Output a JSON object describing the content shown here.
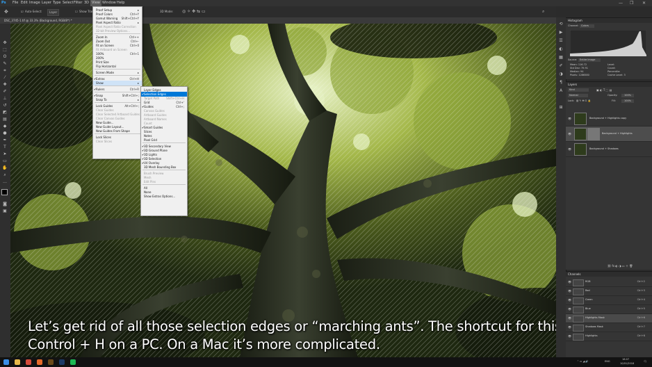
{
  "menubar": {
    "items": [
      "File",
      "Edit",
      "Image",
      "Layer",
      "Type",
      "Select",
      "Filter",
      "3D",
      "View",
      "Window",
      "Help"
    ],
    "window_controls": [
      "—",
      "❐",
      "✕"
    ]
  },
  "options_bar": {
    "auto_select_label": "Auto-Select:",
    "auto_select_value": "Layer",
    "show_transform_label": "Show Transform Controls",
    "mode_label": "3D Mode:"
  },
  "document_tab": {
    "title": "DSC_3745-1.tif @ 33.3% (Background, RGB/8*) *"
  },
  "view_menu": {
    "items": [
      {
        "label": "Proof Setup",
        "shortcut": "▸",
        "type": "normal"
      },
      {
        "label": "Proof Colors",
        "shortcut": "Ctrl+Y",
        "type": "normal"
      },
      {
        "label": "Gamut Warning",
        "shortcut": "Shift+Ctrl+Y",
        "type": "normal"
      },
      {
        "label": "Pixel Aspect Ratio",
        "shortcut": "▸",
        "type": "normal"
      },
      {
        "label": "Pixel Aspect Ratio Correction",
        "shortcut": "",
        "type": "disabled"
      },
      {
        "label": "32-bit Preview Options...",
        "shortcut": "",
        "type": "disabled"
      },
      {
        "type": "sep"
      },
      {
        "label": "Zoom In",
        "shortcut": "Ctrl++",
        "type": "normal"
      },
      {
        "label": "Zoom Out",
        "shortcut": "Ctrl+-",
        "type": "normal"
      },
      {
        "label": "Fit on Screen",
        "shortcut": "Ctrl+0",
        "type": "normal"
      },
      {
        "label": "Fit Artboard on Screen",
        "shortcut": "",
        "type": "disabled"
      },
      {
        "label": "100%",
        "shortcut": "Ctrl+1",
        "type": "normal"
      },
      {
        "label": "200%",
        "shortcut": "",
        "type": "normal"
      },
      {
        "label": "Print Size",
        "shortcut": "",
        "type": "normal"
      },
      {
        "label": "Flip Horizontal",
        "shortcut": "",
        "type": "normal"
      },
      {
        "type": "sep"
      },
      {
        "label": "Screen Mode",
        "shortcut": "▸",
        "type": "normal"
      },
      {
        "type": "sep"
      },
      {
        "label": "Extras",
        "shortcut": "Ctrl+H",
        "type": "checked"
      },
      {
        "label": "Show",
        "shortcut": "▸",
        "type": "submenu"
      },
      {
        "type": "sep"
      },
      {
        "label": "Rulers",
        "shortcut": "Ctrl+R",
        "type": "checked"
      },
      {
        "type": "sep"
      },
      {
        "label": "Snap",
        "shortcut": "Shift+Ctrl+;",
        "type": "checked"
      },
      {
        "label": "Snap To",
        "shortcut": "▸",
        "type": "normal"
      },
      {
        "type": "sep"
      },
      {
        "label": "Lock Guides",
        "shortcut": "Alt+Ctrl+;",
        "type": "normal"
      },
      {
        "label": "Clear Guides",
        "shortcut": "",
        "type": "disabled"
      },
      {
        "label": "Clear Selected Artboard Guides",
        "shortcut": "",
        "type": "disabled"
      },
      {
        "label": "Clear Canvas Guides",
        "shortcut": "",
        "type": "disabled"
      },
      {
        "label": "New Guide...",
        "shortcut": "",
        "type": "normal"
      },
      {
        "label": "New Guide Layout...",
        "shortcut": "",
        "type": "normal"
      },
      {
        "label": "New Guides From Shape",
        "shortcut": "",
        "type": "normal"
      },
      {
        "type": "sep"
      },
      {
        "label": "Lock Slices",
        "shortcut": "",
        "type": "normal"
      },
      {
        "label": "Clear Slices",
        "shortcut": "",
        "type": "disabled"
      }
    ]
  },
  "show_menu": {
    "items": [
      {
        "label": "Layer Edges",
        "shortcut": "",
        "type": "normal"
      },
      {
        "label": "Selection Edges",
        "shortcut": "",
        "type": "highlight"
      },
      {
        "label": "Target Path",
        "shortcut": "Shift+Ctrl+H",
        "type": "disabled"
      },
      {
        "label": "Grid",
        "shortcut": "Ctrl+'",
        "type": "normal"
      },
      {
        "label": "Guides",
        "shortcut": "Ctrl+;",
        "type": "checked"
      },
      {
        "label": "Canvas Guides",
        "shortcut": "",
        "type": "disabled"
      },
      {
        "label": "Artboard Guides",
        "shortcut": "",
        "type": "disabled"
      },
      {
        "label": "Artboard Names",
        "shortcut": "",
        "type": "disabled"
      },
      {
        "label": "Count",
        "shortcut": "",
        "type": "disabled"
      },
      {
        "label": "Smart Guides",
        "shortcut": "",
        "type": "checked"
      },
      {
        "label": "Slices",
        "shortcut": "",
        "type": "normal"
      },
      {
        "label": "Notes",
        "shortcut": "",
        "type": "normal"
      },
      {
        "label": "Pixel Grid",
        "shortcut": "",
        "type": "normal"
      },
      {
        "type": "sep"
      },
      {
        "label": "3D Secondary View",
        "shortcut": "",
        "type": "checked"
      },
      {
        "label": "3D Ground Plane",
        "shortcut": "",
        "type": "checked"
      },
      {
        "label": "3D Lights",
        "shortcut": "",
        "type": "checked"
      },
      {
        "label": "3D Selection",
        "shortcut": "",
        "type": "checked"
      },
      {
        "label": "UV Overlay",
        "shortcut": "",
        "type": "checked"
      },
      {
        "label": "3D Mesh Bounding Box",
        "shortcut": "",
        "type": "normal"
      },
      {
        "type": "sep"
      },
      {
        "label": "Brush Preview",
        "shortcut": "",
        "type": "disabled"
      },
      {
        "label": "Mesh",
        "shortcut": "",
        "type": "disabled"
      },
      {
        "label": "Edit Pins",
        "shortcut": "",
        "type": "disabled"
      },
      {
        "type": "sep"
      },
      {
        "label": "All",
        "shortcut": "",
        "type": "normal"
      },
      {
        "label": "None",
        "shortcut": "",
        "type": "normal"
      },
      {
        "label": "Show Extras Options...",
        "shortcut": "",
        "type": "normal"
      }
    ]
  },
  "histogram_panel": {
    "title": "Histogram",
    "channel_label": "Channel:",
    "channel_value": "Colors",
    "source_label": "Source:",
    "source_value": "Entire Image",
    "stats": [
      "Mean: 116.72",
      "Std Dev: 79.91",
      "Median: 94",
      "Pixels: 1286580",
      "Level:",
      "Count:",
      "Percentile:",
      "Cache Level: 3"
    ]
  },
  "layers_panel": {
    "title": "Layers",
    "search_placeholder": "Kind",
    "blend_mode": "Normal",
    "opacity_label": "Opacity:",
    "opacity_value": "100%",
    "lock_label": "Lock:",
    "fill_label": "Fill:",
    "fill_value": "100%",
    "layers": [
      {
        "name": "Background + Highlights copy",
        "selected": false
      },
      {
        "name": "Background + Highlights",
        "selected": true
      },
      {
        "name": "Background + Shadows",
        "selected": false
      }
    ]
  },
  "channels_panel": {
    "title": "Channels",
    "channels": [
      {
        "name": "RGB",
        "shortcut": "Ctrl+2",
        "selected": false
      },
      {
        "name": "Red",
        "shortcut": "Ctrl+3",
        "selected": false
      },
      {
        "name": "Green",
        "shortcut": "Ctrl+4",
        "selected": false
      },
      {
        "name": "Blue",
        "shortcut": "Ctrl+5",
        "selected": false
      },
      {
        "name": "Highlights Mask",
        "shortcut": "Ctrl+6",
        "selected": true
      },
      {
        "name": "Shadows Mask",
        "shortcut": "Ctrl+7",
        "selected": false
      },
      {
        "name": "Highlights",
        "shortcut": "Ctrl+8",
        "selected": false
      }
    ]
  },
  "subtitle": {
    "line1": "Let’s get rid of all those selection edges or “marching ants”. The shortcut for this is",
    "line2": "Control + H on a PC. On a Mac it’s more complicated."
  },
  "taskbar": {
    "apps": [
      {
        "icon": "windows-icon",
        "color": "#3a8ee6"
      },
      {
        "icon": "file-explorer-icon",
        "color": "#e8b84a"
      },
      {
        "icon": "chrome-icon",
        "color": "#d44a3a"
      },
      {
        "icon": "firefox-icon",
        "color": "#e66a2a"
      },
      {
        "icon": "bridge-icon",
        "color": "#6b4a1a"
      },
      {
        "icon": "photoshop-icon",
        "color": "#1c3a66"
      },
      {
        "icon": "spotify-icon",
        "color": "#1db954"
      }
    ],
    "language": "ENG",
    "time": "18:07",
    "date": "10/01/2018"
  },
  "colors": {
    "menu_highlight": "#0078d7",
    "panel_bg": "#353535",
    "app_bg": "#262626"
  }
}
